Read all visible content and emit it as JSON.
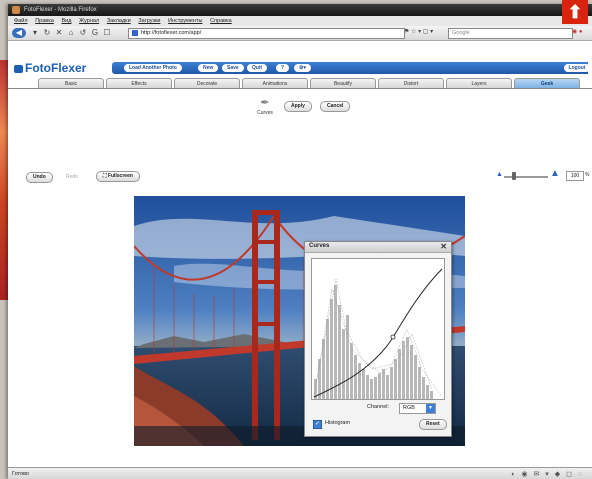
{
  "window": {
    "title": "FotoFlexer - Mozilla Firefox"
  },
  "magazine": {
    "badge_icon": "arrow-up-icon",
    "badge_color": "#d8230e"
  },
  "menu": [
    "Файл",
    "Правка",
    "Вид",
    "Журнал",
    "Закладки",
    "Загрузки",
    "Инструменты",
    "Справка"
  ],
  "browser": {
    "url": "http://fotoflexer.com/app/",
    "search_placeholder": "Google"
  },
  "app": {
    "logo": "FotoFlexer",
    "top_buttons": [
      "Load Another Photo",
      "New",
      "Save",
      "Quit"
    ],
    "logout": "Logout",
    "tabs": [
      "Basic",
      "Effects",
      "Decorate",
      "Animations",
      "Beautify",
      "Distort",
      "Layers",
      "Geek"
    ],
    "active_tab": "Geek",
    "tool_label": "Curves",
    "apply_label": "Apply",
    "cancel_label": "Cancel",
    "undo_label": "Undo",
    "redo_label": "Redo",
    "fullscreen_label": "Fullscreen",
    "zoom_value": "100",
    "zoom_unit": "%"
  },
  "curves_dialog": {
    "title": "Curves",
    "channel_label": "Channel:",
    "channel_value": "RGB",
    "histogram_label": "Histogram",
    "histogram_checked": true,
    "reset_label": "Reset"
  },
  "status": {
    "text": "Готово"
  },
  "colors": {
    "brand_blue": "#1f57a8",
    "active_tab": "#7aaee0",
    "bridge_red": "#c0392b"
  }
}
